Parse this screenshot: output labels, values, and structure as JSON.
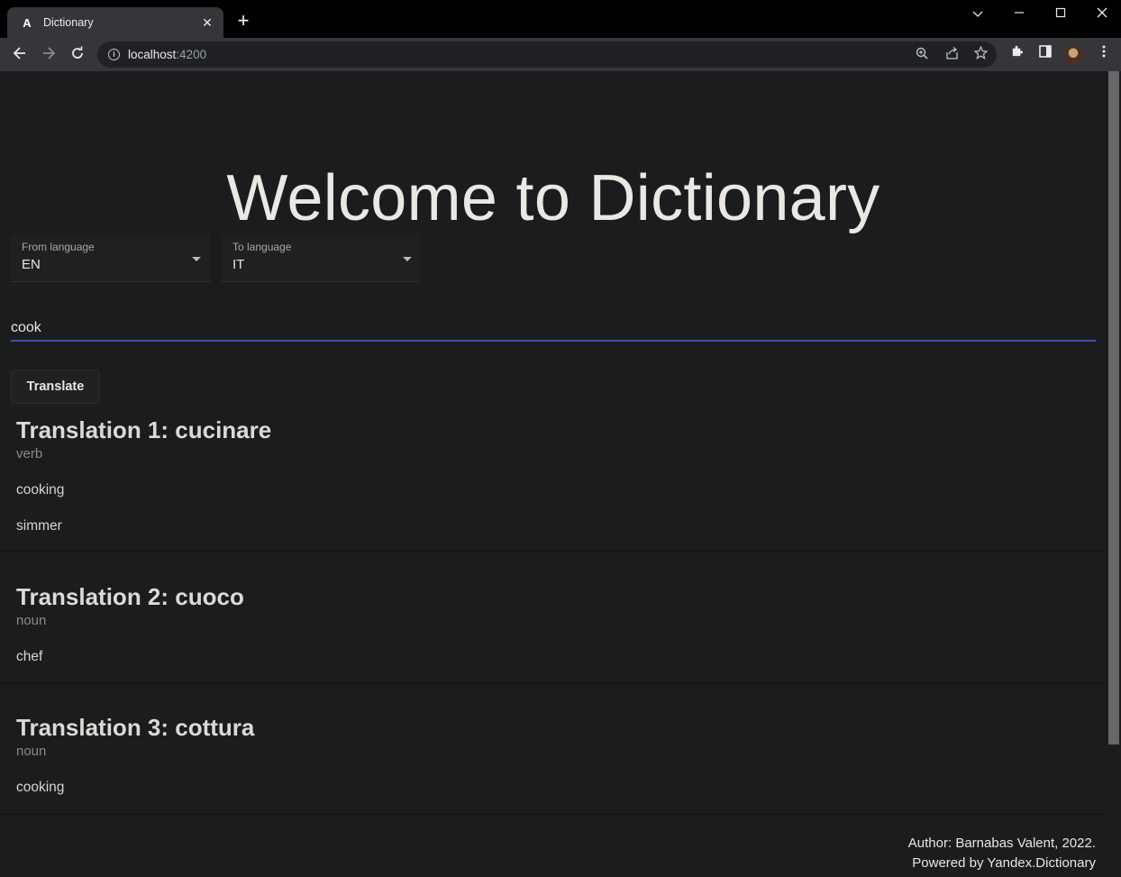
{
  "browser": {
    "tab_title": "Dictionary",
    "tab_favicon": "A",
    "url_host": "localhost",
    "url_port": ":4200"
  },
  "page": {
    "heading": "Welcome to Dictionary",
    "from_language": {
      "label": "From language",
      "value": "EN"
    },
    "to_language": {
      "label": "To language",
      "value": "IT"
    },
    "search_value": "cook",
    "translate_button": "Translate",
    "translations": [
      {
        "title": "Translation 1: cucinare",
        "type": "verb",
        "meanings": [
          "cooking",
          "simmer"
        ]
      },
      {
        "title": "Translation 2: cuoco",
        "type": "noun",
        "meanings": [
          "chef"
        ]
      },
      {
        "title": "Translation 3: cottura",
        "type": "noun",
        "meanings": [
          "cooking"
        ]
      }
    ],
    "footer": {
      "author": "Author: Barnabas Valent, 2022.",
      "powered": "Powered by Yandex.Dictionary"
    }
  }
}
